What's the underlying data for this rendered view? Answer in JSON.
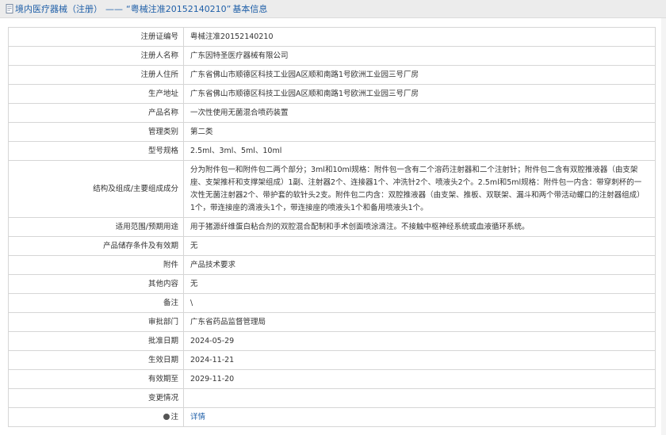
{
  "header": {
    "link_label": "境内医疗器械（注册）",
    "separator": "——",
    "quoted_title": "“粤械注准20152140210”",
    "suffix": "基本信息"
  },
  "rows": [
    {
      "label": "注册证编号",
      "value": "粤械注准20152140210"
    },
    {
      "label": "注册人名称",
      "value": "广东因特圣医疗器械有限公司"
    },
    {
      "label": "注册人住所",
      "value": "广东省佛山市顺德区科技工业园A区顺和南路1号欧洲工业园三号厂房"
    },
    {
      "label": "生产地址",
      "value": "广东省佛山市顺德区科技工业园A区顺和南路1号欧洲工业园三号厂房"
    },
    {
      "label": "产品名称",
      "value": "一次性使用无菌混合喷药装置"
    },
    {
      "label": "管理类别",
      "value": "第二类"
    },
    {
      "label": "型号规格",
      "value": "2.5ml、3ml、5ml、10ml"
    },
    {
      "label": "结构及组成/主要组成成分",
      "value": "分为附件包一和附件包二两个部分；3ml和10ml规格：附件包一含有二个溶药注射器和二个注射针；附件包二含有双腔推液器（由支架座、支架推杆和支撑架组成）1副、注射器2个、连接器1个、冲洗针2个、喷液头2个。2.5ml和5ml规格：附件包一内含：带穿刺杯的一次性无菌注射器2个、带护套的软针头2支。附件包二内含：双腔推液器（由支架、推板、双联架、漏斗和两个带活动螺口的注射器组成）1个，带连接座的滴液头1个，带连接座的喷液头1个和备用喷液头1个。"
    },
    {
      "label": "适用范围/预期用途",
      "value": "用于猪源纤维蛋白粘合剂的双腔混合配制和手术创面喷涂滴注。不接触中枢神经系统或血液循环系统。"
    },
    {
      "label": "产品储存条件及有效期",
      "value": "无"
    },
    {
      "label": "附件",
      "value": "产品技术要求"
    },
    {
      "label": "其他内容",
      "value": "无"
    },
    {
      "label": "备注",
      "value": "\\"
    },
    {
      "label": "审批部门",
      "value": "广东省药品监督管理局"
    },
    {
      "label": "批准日期",
      "value": "2024-05-29"
    },
    {
      "label": "生效日期",
      "value": "2024-11-21"
    },
    {
      "label": "有效期至",
      "value": "2029-11-20"
    },
    {
      "label": "变更情况",
      "value": ""
    }
  ],
  "footnote": {
    "label": "注",
    "link_text": "详情"
  }
}
